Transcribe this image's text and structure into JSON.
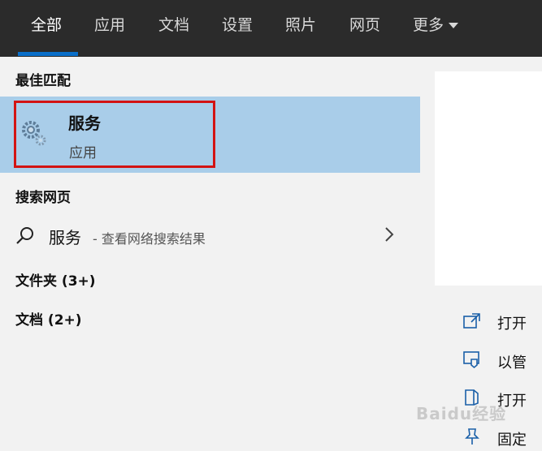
{
  "tabs": [
    {
      "label": "全部"
    },
    {
      "label": "应用"
    },
    {
      "label": "文档"
    },
    {
      "label": "设置"
    },
    {
      "label": "照片"
    },
    {
      "label": "网页"
    },
    {
      "label": "更多"
    }
  ],
  "left": {
    "best_match_title": "最佳匹配",
    "best_match": {
      "name": "服务",
      "type": "应用"
    },
    "search_web_title": "搜索网页",
    "web_result": {
      "term": "服务",
      "hint": "- 查看网络搜索结果"
    },
    "folders": "文件夹 (3+)",
    "documents": "文档 (2+)"
  },
  "right": {
    "actions": [
      {
        "label": "打开"
      },
      {
        "label": "以管"
      },
      {
        "label": "打开"
      },
      {
        "label": "固定"
      }
    ]
  },
  "watermark": "Baidu经验",
  "colors": {
    "accent": "#0a6fc9",
    "highlight": "#a9cde9",
    "annotation": "#d31313",
    "topbar": "#2b2b2b"
  }
}
